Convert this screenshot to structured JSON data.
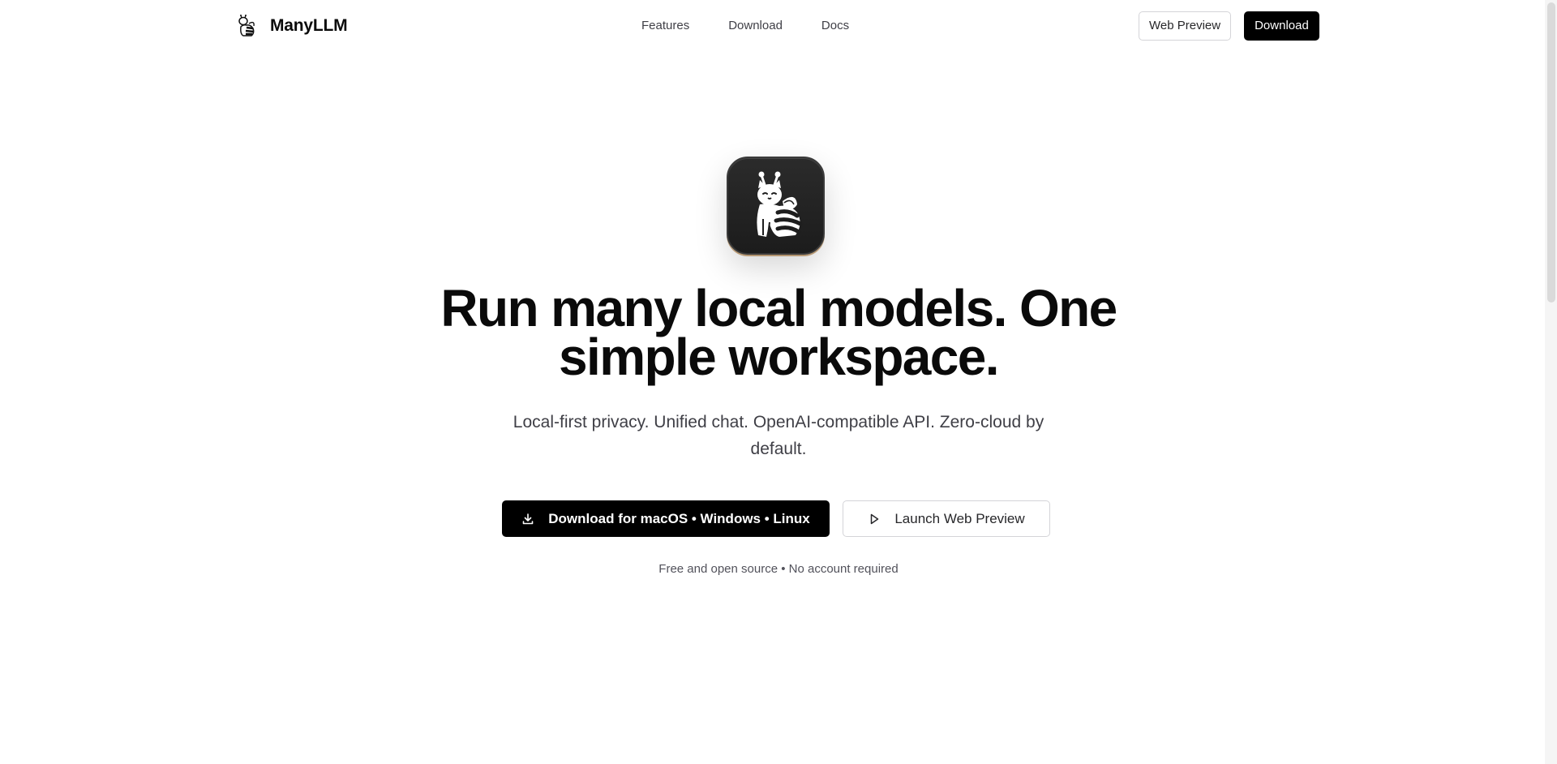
{
  "header": {
    "brand_name": "ManyLLM",
    "logo_icon": "bee-cat-icon",
    "nav": [
      {
        "label": "Features"
      },
      {
        "label": "Download"
      },
      {
        "label": "Docs"
      }
    ],
    "web_preview_label": "Web Preview",
    "download_label": "Download"
  },
  "hero": {
    "app_icon": "bee-cat-app-icon",
    "headline": "Run many local models. One simple workspace.",
    "subtitle": "Local-first privacy. Unified chat. OpenAI-compatible API. Zero-cloud by default.",
    "primary_cta": {
      "label": "Download for macOS • Windows • Linux",
      "icon": "download-icon"
    },
    "secondary_cta": {
      "label": "Launch Web Preview",
      "icon": "play-icon"
    },
    "footnote": "Free and open source • No account required"
  },
  "colors": {
    "primary": "#000000",
    "text": "#0a0a0a",
    "muted": "#3f3f46",
    "border": "#d4d4d8",
    "icon_bg": "#222222",
    "icon_rim": "#b27d3c"
  }
}
